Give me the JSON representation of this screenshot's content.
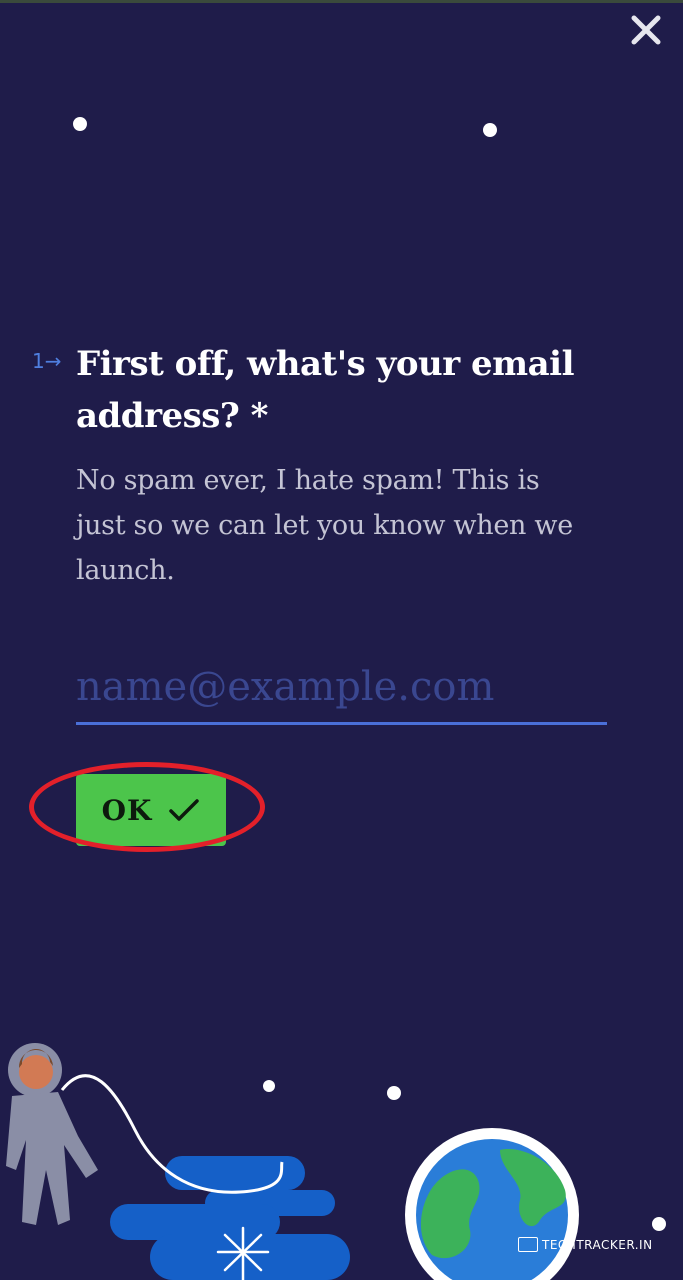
{
  "header": {
    "close_icon": "close-icon"
  },
  "question": {
    "number": "1",
    "arrow_icon": "arrow-right-icon",
    "text_start": "First off, what's your ",
    "text_bold": "email address",
    "text_end": "? *",
    "description": "No spam ever, I hate spam! This is just so we can let you know when we launch."
  },
  "email_input": {
    "placeholder": "name@example.com",
    "value": ""
  },
  "ok_button": {
    "label": "OK",
    "icon": "checkmark-icon"
  },
  "watermark": {
    "text": "TECHTRACKER.IN"
  },
  "colors": {
    "background": "#1f1c4a",
    "accent": "#4a6fd8",
    "ok_green": "#4cc54b",
    "highlight_red": "#e3202a"
  }
}
